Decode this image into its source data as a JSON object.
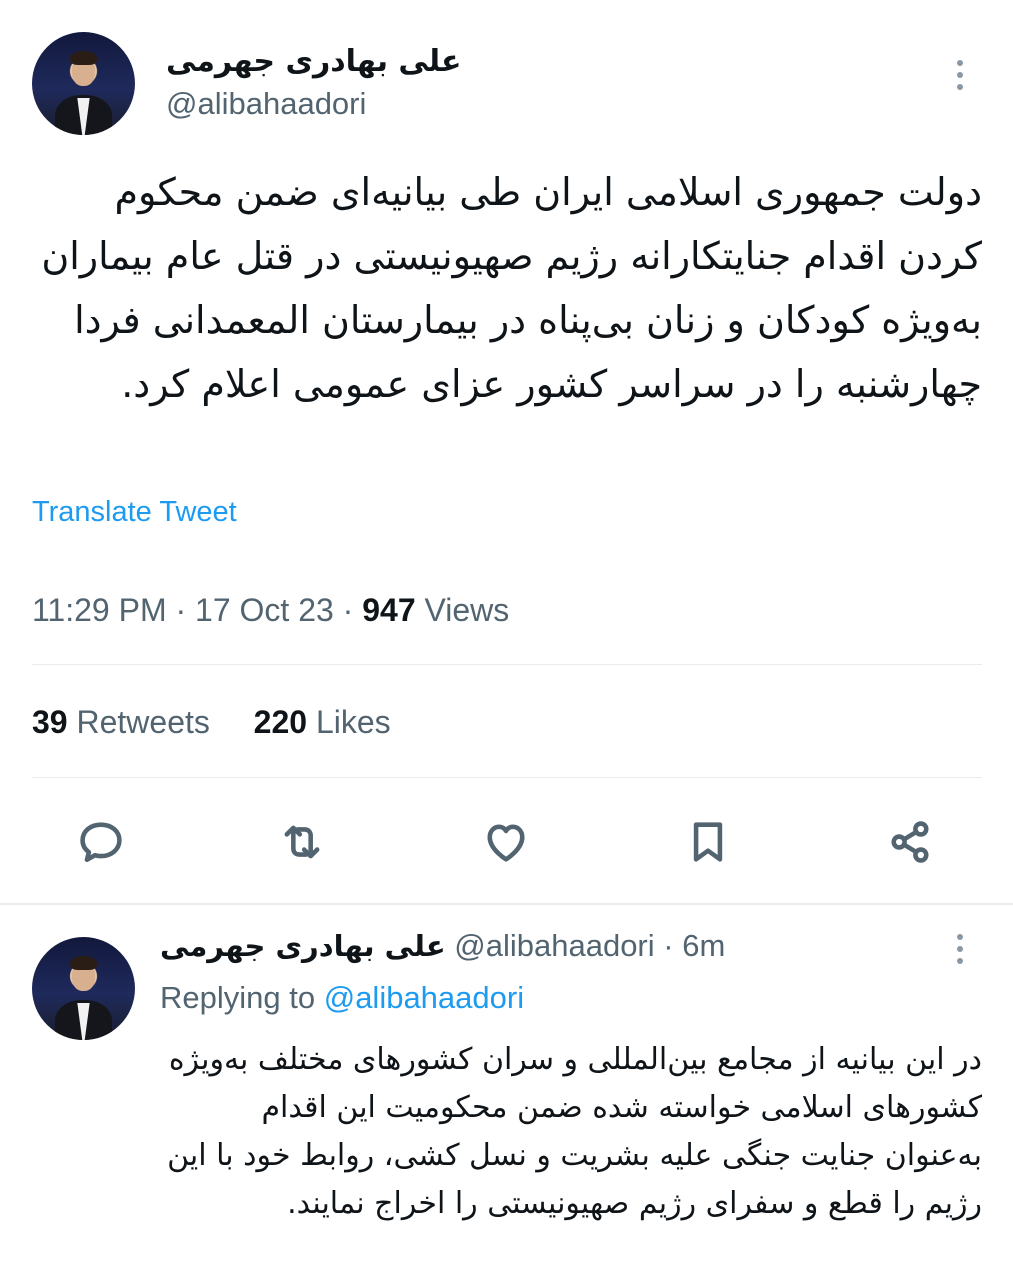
{
  "tweet": {
    "author_name": "علی بهادری جهرمی",
    "author_handle": "@alibahaadori",
    "text": "دولت جمهوری اسلامی ایران طی بیانیه‌ای ضمن محکوم کردن اقدام جنایتکارانه رژیم صهیونیستی در قتل عام بیماران به‌ویژه کودکان و زنان بی‌پناه در بیمارستان المعمدانی فردا چهارشنبه را در سراسر کشور عزای عمومی اعلام کرد.",
    "translate_label": "Translate Tweet",
    "time": "11:29 PM",
    "date": "17 Oct 23",
    "views_count": "947",
    "views_label": "Views",
    "retweets_count": "39",
    "retweets_label": "Retweets",
    "likes_count": "220",
    "likes_label": "Likes",
    "actions": [
      "reply-icon",
      "retweet-icon",
      "like-icon",
      "bookmark-icon",
      "share-icon"
    ]
  },
  "reply": {
    "author_name": "علی بهادری جهرمی",
    "author_handle": "@alibahaadori",
    "age": "6m",
    "replying_label": "Replying to",
    "replying_to": "@alibahaadori",
    "text": "در این بیانیه از مجامع بین‌المللی و سران کشورهای مختلف به‌ویژه کشورهای اسلامی خواسته شده ضمن محکومیت این اقدام به‌عنوان جنایت جنگی علیه بشریت و نسل کشی، روابط خود با این رژیم را قطع و سفرای رژیم صهیونیستی را اخراج نمایند."
  },
  "colors": {
    "link": "#1d9bf0",
    "secondary_text": "#536471",
    "primary_text": "#0f1419"
  }
}
